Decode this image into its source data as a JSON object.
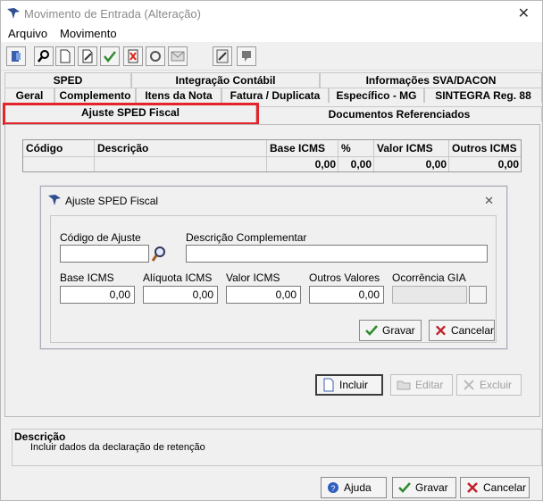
{
  "window": {
    "title": "Movimento de Entrada (Alteração)",
    "close_glyph": "✕"
  },
  "menu": {
    "items": [
      "Arquivo",
      "Movimento"
    ]
  },
  "toolbar": {
    "icons": [
      "exit-icon",
      "search-icon",
      "new-document-icon",
      "edit-document-icon",
      "confirm-check-icon",
      "delete-icon",
      "refresh-icon",
      "mail-icon",
      "calculator-icon",
      "stamp-icon"
    ]
  },
  "tabs": {
    "row1": [
      "SPED",
      "Integração Contábil",
      "Informações SVA/DACON"
    ],
    "row2": [
      "Geral",
      "Complemento",
      "Itens da Nota",
      "Fatura / Duplicata",
      "Específico - MG",
      "SINTEGRA Reg. 88"
    ],
    "row3": [
      "Ajuste SPED Fiscal",
      "Documentos Referenciados"
    ]
  },
  "grid": {
    "headers": [
      "Código",
      "Descrição",
      "Base ICMS",
      "%",
      "Valor ICMS",
      "Outros ICMS"
    ],
    "row": [
      "",
      "",
      "0,00",
      "0,00",
      "0,00",
      "0,00"
    ]
  },
  "dialog": {
    "title": "Ajuste SPED Fiscal",
    "close_glyph": "✕",
    "codigo_label": "Código de Ajuste",
    "codigo_value": "",
    "descricao_label": "Descrição Complementar",
    "descricao_value": "",
    "base_label": "Base ICMS",
    "base_value": "0,00",
    "aliquota_label": "Alíquota ICMS",
    "aliquota_value": "0,00",
    "valor_label": "Valor ICMS",
    "valor_value": "0,00",
    "outros_label": "Outros Valores",
    "outros_value": "0,00",
    "ocorrencia_label": "Ocorrência GIA",
    "ocorrencia_value": "",
    "gravar": "Gravar",
    "cancelar": "Cancelar"
  },
  "actions": {
    "incluir": "Incluir",
    "editar": "Editar",
    "excluir": "Excluir"
  },
  "description": {
    "title": "Descrição",
    "text": "Incluir dados da declaração de retenção"
  },
  "footer": {
    "ajuda": "Ajuda",
    "gravar": "Gravar",
    "cancelar": "Cancelar"
  },
  "colors": {
    "highlight": "#e3242b",
    "check": "#2e8b2e",
    "cancel": "#c0202a"
  }
}
